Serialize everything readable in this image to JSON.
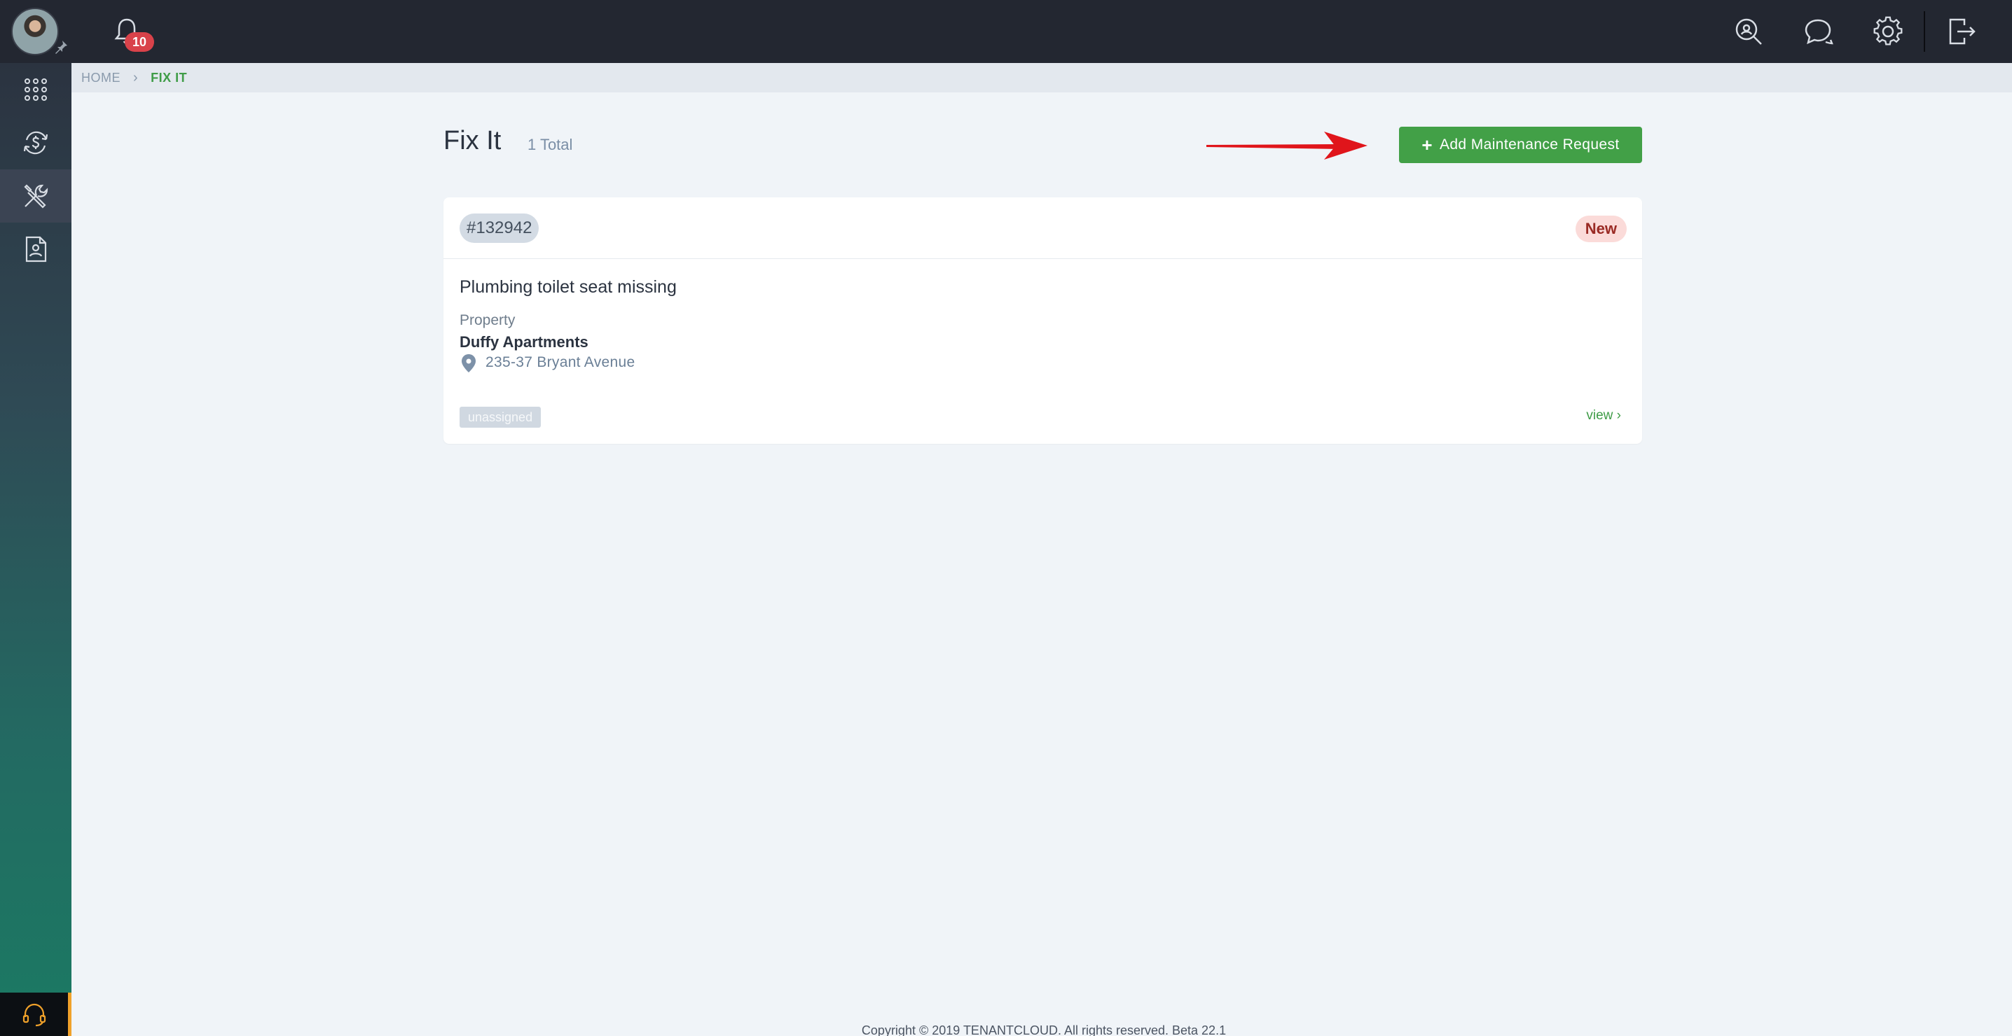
{
  "topbar": {
    "notifications_count": "10",
    "icons": [
      "search-icon",
      "chat-icon",
      "gear-icon",
      "logout-icon"
    ]
  },
  "sidebar": {
    "items": [
      {
        "icon": "apps-grid-icon",
        "active": false
      },
      {
        "icon": "payments-icon",
        "active": false
      },
      {
        "icon": "tools-icon",
        "active": true
      },
      {
        "icon": "tenant-document-icon",
        "active": false
      }
    ],
    "bottom_icon": "headset-icon"
  },
  "breadcrumb": {
    "home": "HOME",
    "current": "FIX IT"
  },
  "header": {
    "title": "Fix It",
    "count": "1 Total",
    "add_button_label": "Add Maintenance Request"
  },
  "requests": [
    {
      "id": "#132942",
      "status": "New",
      "title": "Plumbing toilet seat missing",
      "property_label": "Property",
      "property_name": "Duffy Apartments",
      "address": "235-37 Bryant Avenue",
      "assignee": "unassigned",
      "view_label": "view ›"
    }
  ],
  "footer": {
    "text": "Copyright © 2019 TENANTCLOUD. All rights reserved. Beta 22.1"
  },
  "colors": {
    "topbar": "#232731",
    "accent_green": "#42a047",
    "status_new_bg": "#fbdbd9",
    "annotation_arrow": "#e0151b"
  }
}
